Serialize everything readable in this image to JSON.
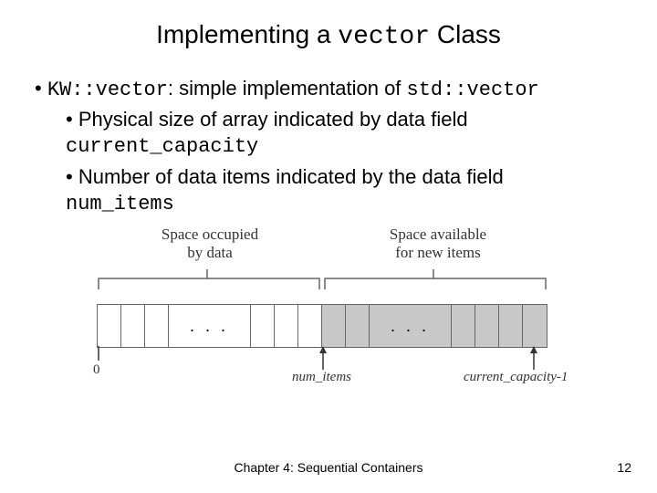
{
  "title": {
    "pre": "Implementing a ",
    "code": "vector",
    "post": " Class"
  },
  "bullets": {
    "top": {
      "code1": "KW::vector",
      "mid": ": simple implementation of ",
      "code2": "std::vector"
    },
    "sub1": {
      "text": "Physical size of array indicated by data field ",
      "code": "current_capacity"
    },
    "sub2": {
      "text": "Number of data items indicated by the data field ",
      "code": "num_items"
    }
  },
  "diagram": {
    "left_label_l1": "Space occupied",
    "left_label_l2": "by data",
    "right_label_l1": "Space available",
    "right_label_l2": "for new items",
    "dots": ". . .",
    "zero": "0",
    "num_items": "num_items",
    "capacity": "current_capacity-1"
  },
  "footer": {
    "center": "Chapter 4: Sequential Containers",
    "page": "12"
  }
}
